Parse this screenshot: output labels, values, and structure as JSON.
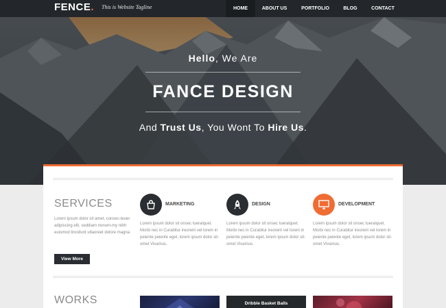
{
  "header": {
    "logo_text": "FENCE",
    "logo_dot": ".",
    "tagline": "This is Website Tagline",
    "nav": [
      {
        "label": "HOME",
        "active": true
      },
      {
        "label": "ABOUT US",
        "active": false
      },
      {
        "label": "PORTFOLIO",
        "active": false
      },
      {
        "label": "BLOG",
        "active": false
      },
      {
        "label": "CONTACT",
        "active": false
      }
    ]
  },
  "hero": {
    "hello_prefix": "Hello",
    "hello_rest": ", We Are",
    "title": "FANCE DESIGN",
    "sub_1": "And ",
    "sub_2": "Trust Us",
    "sub_3": ", You Wont To ",
    "sub_4": "Hire Us",
    "sub_5": "."
  },
  "services": {
    "title": "SERVICES",
    "description": "Lorem ipsum dolor sit amet, consec-teuer adipiscing elit, seddiam nonum-my nibh euismod tincidunt utlaoreet dolore magna",
    "button_label": "View More",
    "items": [
      {
        "title": "MARKETING",
        "icon": "marketing-icon",
        "text": "Lorem ipsum dolor sit onsec tueralquet. Morbi nec in Curabitur ireorent vel lorem in peiente peiente eget, lorem ipsum dolor sit-omet Vivamus."
      },
      {
        "title": "DESIGN",
        "icon": "design-icon",
        "text": "Lorem ipsum dolor sit onsec tueralquet. Morbi nec in Curabitur ireorent vel lorem in peiente peiente eget, lorem ipsum dolor sit-omet Vivamus."
      },
      {
        "title": "DEVELOPMENT",
        "icon": "development-icon",
        "text": "Lorem ipsum dolor sit onsec tueralquet. Morbi nec in Curabitur ireorent vel lorem in peiente peiente eget, lorem ipsum dolor sit-omet Vivamus."
      }
    ]
  },
  "works": {
    "title": "WORKS",
    "items": [
      {
        "caption": ""
      },
      {
        "caption": "Dribble Basket Balls"
      },
      {
        "caption": ""
      }
    ]
  },
  "colors": {
    "accent": "#ef6c33",
    "dark": "#23272b",
    "text_muted": "#8a8a8a"
  }
}
